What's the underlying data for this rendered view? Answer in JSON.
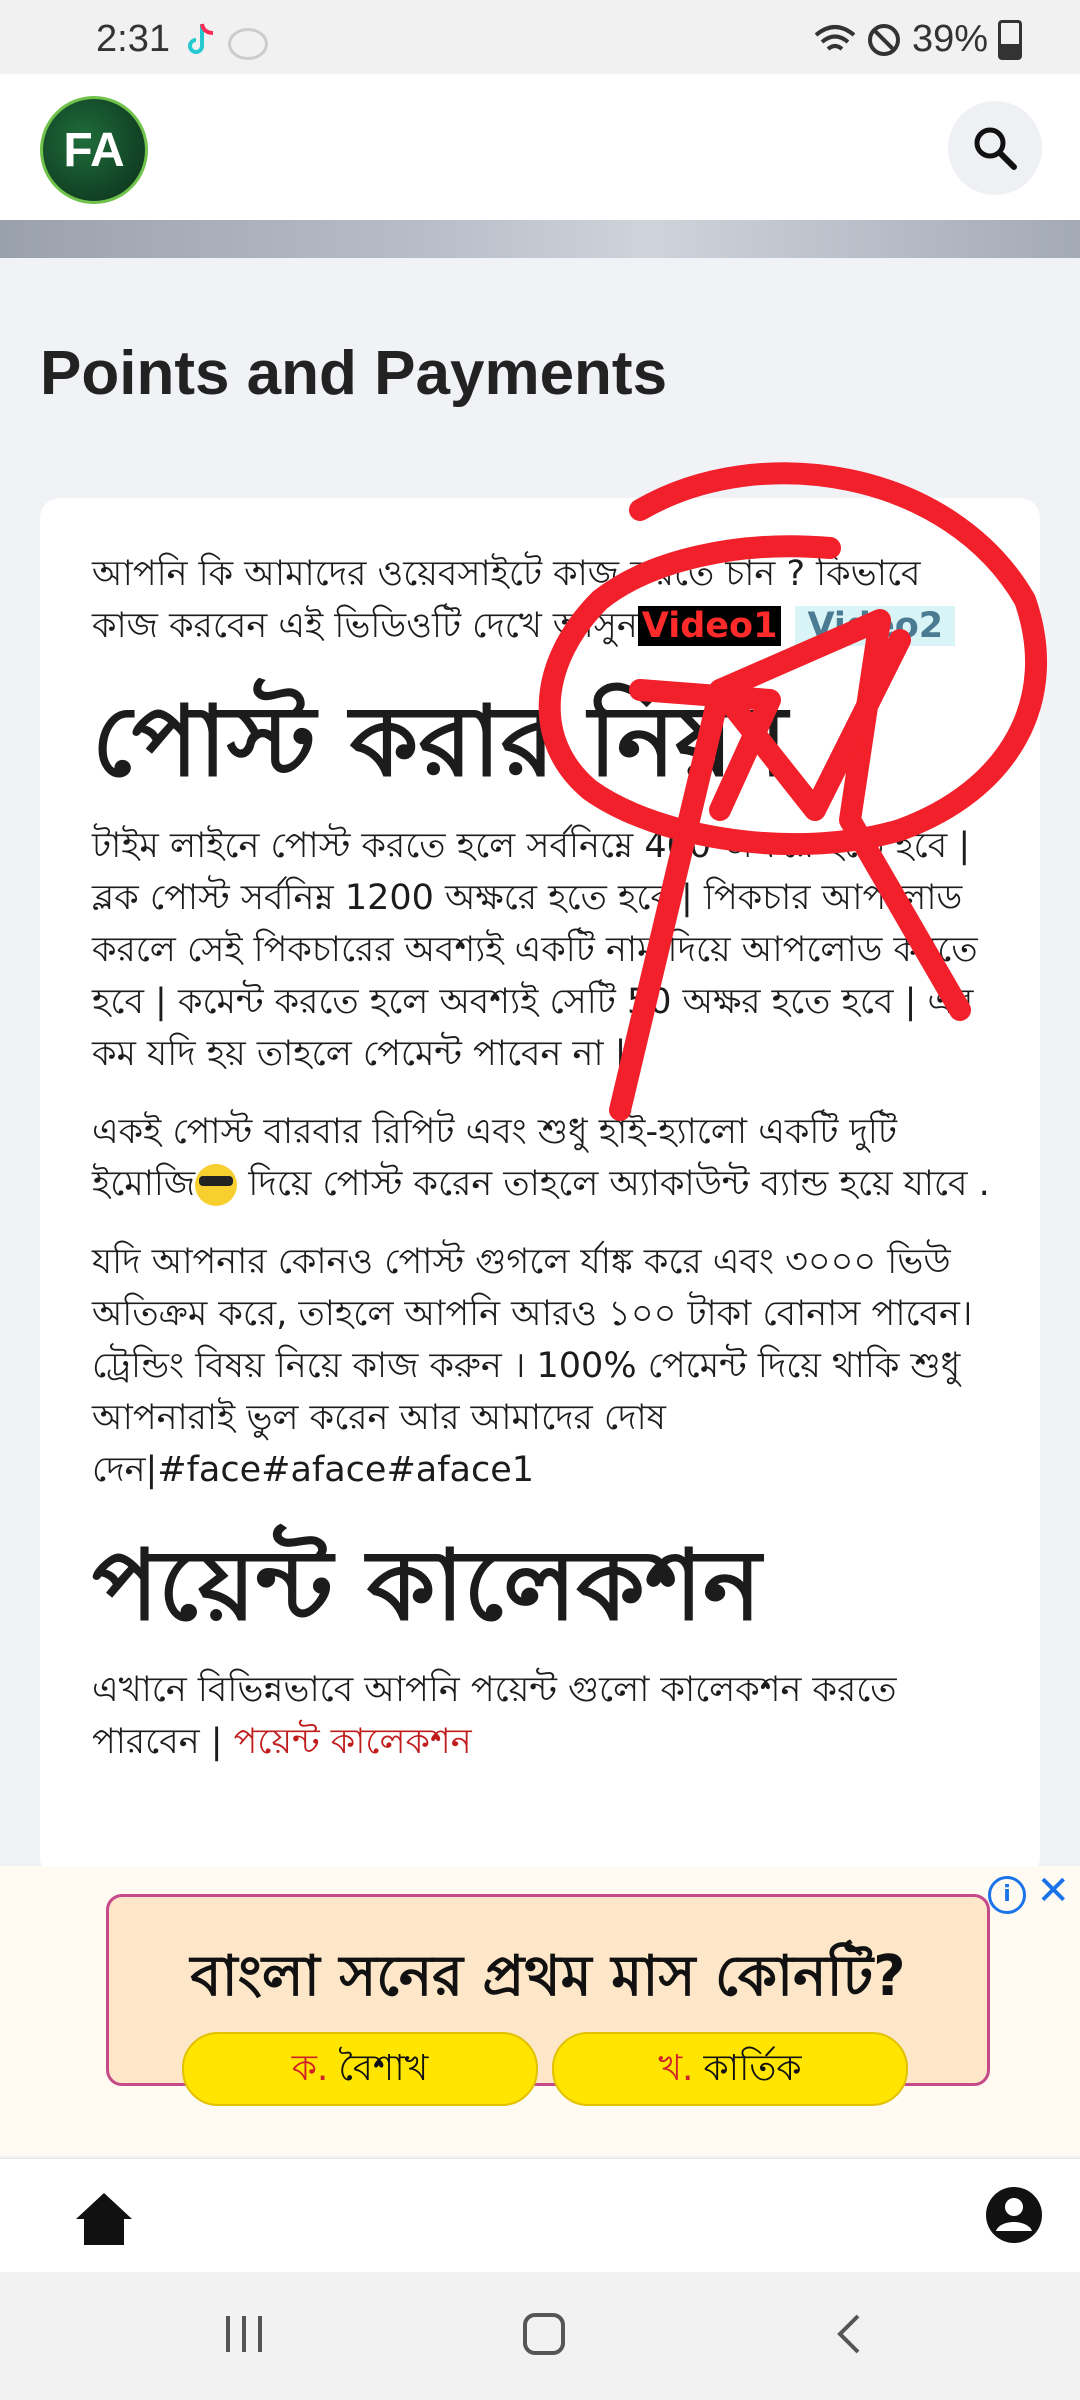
{
  "status": {
    "time": "2:31",
    "battery": "39%"
  },
  "header": {
    "logo_text": "FA"
  },
  "page": {
    "title": "Points and Payments"
  },
  "intro": {
    "text": "আপনি কি আমাদের ওয়েবসাইটে কাজ করতে চান ? কিভাবে কাজ করবেন এই ভিডিওটি দেখে আসুন",
    "video1": "Video1",
    "video2": "Video2"
  },
  "rules": {
    "heading": "পোস্ট করার নিয়ম",
    "p1": "টাইম লাইনে পোস্ট করতে হলে সর্বনিম্নে 400 অক্ষরে হতে হবে | ব্লক পোস্ট সর্বনিম্ন 1200 অক্ষরে হতে হবে | পিকচার আপলোড করলে সেই পিকচারের অবশ্যই একটি নাম দিয়ে আপলোড করতে হবে | কমেন্ট করতে হলে অবশ্যই সেটি 50 অক্ষর হতে হবে | এর কম যদি হয় তাহলে পেমেন্ট পাবেন না |",
    "p2a": "একই পোস্ট বারবার রিপিট এবং শুধু হাই-হ্যালো একটি দুটি ইমোজি",
    "p2b": " দিয়ে পোস্ট করেন তাহলে অ্যাকাউন্ট ব্যান্ড হয়ে যাবে .",
    "p3": "যদি আপনার কোনও পোস্ট গুগলে র্যাঙ্ক করে এবং ৩০০০ ভিউ অতিক্রম করে, তাহলে আপনি আরও ১০০ টাকা বোনাস পাবেন। ট্রেন্ডিং বিষয় নিয়ে কাজ করুন । 100% পেমেন্ট দিয়ে থাকি শুধু আপনারাই ভুল করেন আর আমাদের দোষ দেন|#face#aface#aface1"
  },
  "points": {
    "heading": "পয়েন্ট কালেকশন",
    "text": "এখানে বিভিন্নভাবে আপনি পয়েন্ট গুলো কালেকশন করতে পারবেন | ",
    "link": "পয়েন্ট কালেকশন"
  },
  "ad": {
    "question": "বাংলা সনের প্রথম মাস কোনটি?",
    "options": [
      {
        "key": "ক.",
        "label": "বৈশাখ"
      },
      {
        "key": "খ.",
        "label": "কার্তিক"
      }
    ]
  },
  "colors": {
    "annotation": "#f2202a",
    "link": "#c01c1c",
    "video1_bg": "#000000",
    "video2_bg": "#d9f4f6"
  }
}
